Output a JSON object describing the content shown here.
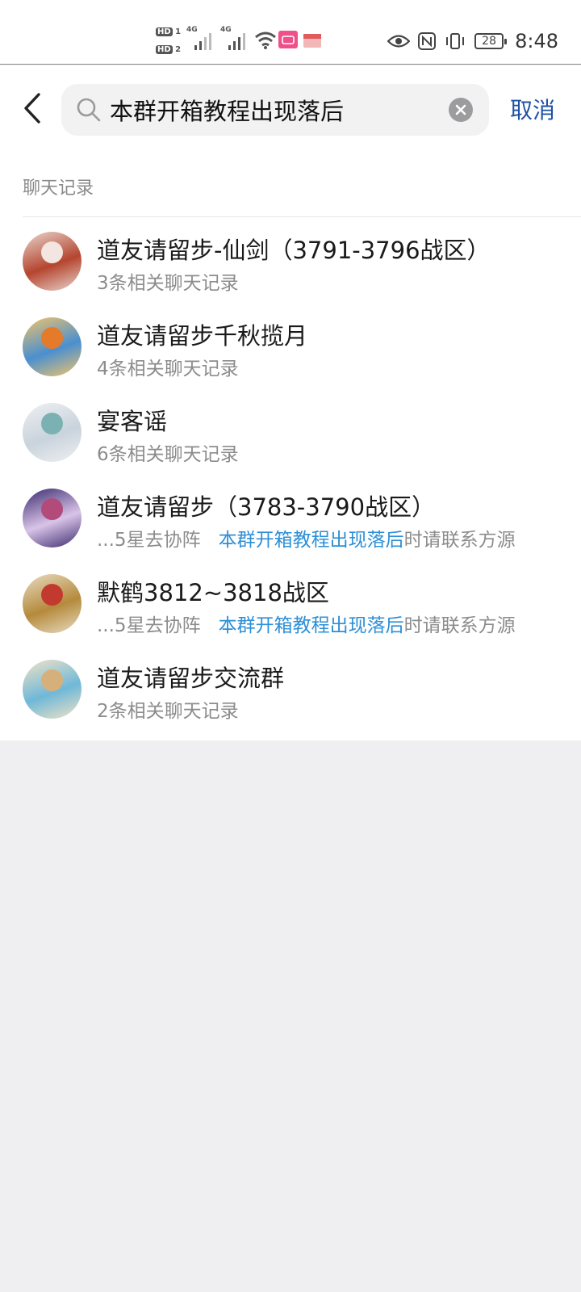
{
  "status_bar": {
    "hd1": "HD",
    "hd1_num": "1",
    "hd2": "HD",
    "hd2_num": "2",
    "net1": "4G",
    "net2": "4G",
    "battery": "28",
    "time": "8:48"
  },
  "search": {
    "query": "本群开箱教程出现落后",
    "cancel_label": "取消"
  },
  "section_title": "聊天记录",
  "results": [
    {
      "title": "道友请留步-仙剑（3791-3796战区）",
      "sub": "3条相关聊天记录",
      "avatar_colors": [
        "#e9d7cf",
        "#b5452f",
        "#f3e6e0"
      ]
    },
    {
      "title": "道友请留步千秋揽月",
      "sub": "4条相关聊天记录",
      "avatar_colors": [
        "#f3c46a",
        "#4a8fd0",
        "#e67a2b"
      ]
    },
    {
      "title": "宴客谣",
      "sub": "6条相关聊天记录",
      "avatar_colors": [
        "#eef0f2",
        "#c9d3dc",
        "#7bb1b3"
      ]
    },
    {
      "title": "道友请留步（3783-3790战区）",
      "sub_prefix": "...5星去协阵",
      "sub_highlight": "本群开箱教程出现落后",
      "sub_suffix": "时请联系方源",
      "avatar_colors": [
        "#3a2a6e",
        "#d9c4e8",
        "#b24a7a"
      ]
    },
    {
      "title": "默鹤3812~3818战区",
      "sub_prefix": "...5星去协阵",
      "sub_highlight": "本群开箱教程出现落后",
      "sub_suffix": "时请联系方源",
      "avatar_colors": [
        "#e8dcc2",
        "#b58a3c",
        "#c23a2f"
      ]
    },
    {
      "title": "道友请留步交流群",
      "sub": "2条相关聊天记录",
      "avatar_colors": [
        "#f2e3c6",
        "#6fb8d8",
        "#d6b07a"
      ]
    }
  ],
  "colors": {
    "accent_link": "#1f52a3",
    "highlight": "#2d8fd6",
    "page_bg": "#efeff1"
  }
}
